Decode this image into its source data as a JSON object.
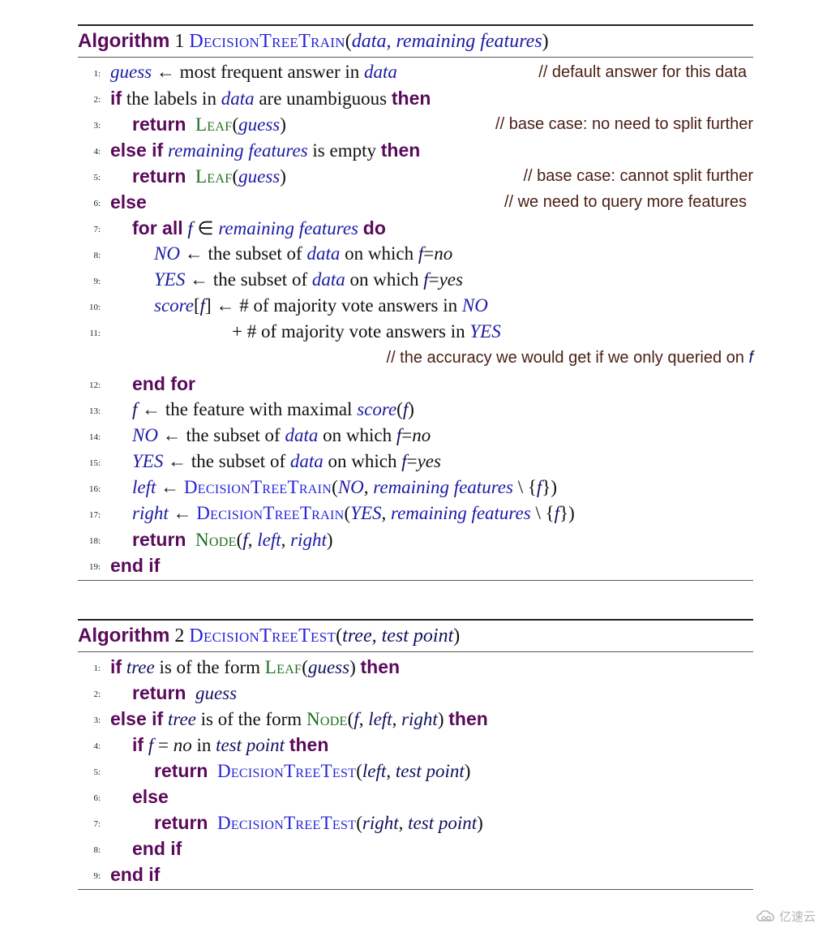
{
  "algorithm1": {
    "label": "Algorithm",
    "number": "1",
    "name": "DecisionTreeTrain",
    "params": "data, remaining features",
    "lines": [
      {
        "num": "1:",
        "parts": [
          "guess",
          " ←  most frequent answer in ",
          "data"
        ],
        "comment": "// default answer for this data"
      },
      {
        "num": "2:",
        "kw1": "if",
        "text": " the labels in ",
        "var": "data",
        "text2": " are unambiguous ",
        "kw2": "then"
      },
      {
        "num": "3:",
        "kw": "return",
        "func": "Leaf",
        "arg": "guess",
        "comment": "// base case: no need to split further"
      },
      {
        "num": "4:",
        "kw1": "else if",
        "var": "remaining features",
        "text": " is empty ",
        "kw2": "then"
      },
      {
        "num": "5:",
        "kw": "return",
        "func": "Leaf",
        "arg": "guess",
        "comment": "// base case: cannot split further"
      },
      {
        "num": "6:",
        "kw": "else",
        "comment": "// we need to query more features"
      },
      {
        "num": "7:",
        "kw1": "for all",
        "var1": "f",
        "sym": " ∈ ",
        "var2": "remaining features",
        "kw2": "do"
      },
      {
        "num": "8:",
        "var1": "NO",
        "text": " ←  the subset of ",
        "var2": "data",
        "text2": " on which ",
        "var3": "f",
        "eq": "=",
        "val": "no"
      },
      {
        "num": "9:",
        "var1": "YES",
        "text": " ←  the subset of ",
        "var2": "data",
        "text2": " on which ",
        "var3": "f",
        "eq": "=",
        "val": "yes"
      },
      {
        "num": "10:",
        "var1": "score",
        "br1": "[",
        "var2": "f",
        "br2": "]",
        "text": " ← # of majority vote answers in ",
        "var3": "NO"
      },
      {
        "num": "11:",
        "text": "+ # of majority vote answers in ",
        "var": "YES"
      },
      {
        "comment_text": "// the accuracy we would get if we only queried on ",
        "comment_var": "f"
      },
      {
        "num": "12:",
        "kw": "end for"
      },
      {
        "num": "13:",
        "var1": "f",
        "text": " ←  the feature with maximal ",
        "var2": "score",
        "p1": "(",
        "var3": "f",
        "p2": ")"
      },
      {
        "num": "14:",
        "var1": "NO",
        "text": " ←  the subset of ",
        "var2": "data",
        "text2": " on which ",
        "var3": "f",
        "eq": "=",
        "val": "no"
      },
      {
        "num": "15:",
        "var1": "YES",
        "text": " ←  the subset of ",
        "var2": "data",
        "text2": " on which ",
        "var3": "f",
        "eq": "=",
        "val": "yes"
      },
      {
        "num": "16:",
        "var1": "left",
        "arrow": " ←  ",
        "func": "DecisionTreeTrain",
        "arg1": "NO",
        "sep": ", ",
        "arg2": "remaining features",
        "set": " \\ {",
        "arg3": "f",
        "close": "})"
      },
      {
        "num": "17:",
        "var1": "right",
        "arrow": " ←  ",
        "func": "DecisionTreeTrain",
        "arg1": "YES",
        "sep": ", ",
        "arg2": "remaining features",
        "set": " \\ {",
        "arg3": "f",
        "close": "})"
      },
      {
        "num": "18:",
        "kw": "return",
        "func": "Node",
        "arg1": "f",
        "arg2": "left",
        "arg3": "right"
      },
      {
        "num": "19:",
        "kw": "end if"
      }
    ]
  },
  "algorithm2": {
    "label": "Algorithm",
    "number": "2",
    "name": "DecisionTreeTest",
    "params": "tree, test point",
    "lines": [
      {
        "num": "1:",
        "kw1": "if",
        "var": "tree",
        "text": " is of the form ",
        "func": "Leaf",
        "arg": "guess",
        "kw2": "then"
      },
      {
        "num": "2:",
        "kw": "return",
        "var": "guess"
      },
      {
        "num": "3:",
        "kw1": "else if",
        "var": "tree",
        "text": " is of the form ",
        "func": "Node",
        "arg1": "f",
        "arg2": "left",
        "arg3": "right",
        "kw2": "then"
      },
      {
        "num": "4:",
        "kw1": "if",
        "var1": "f",
        "eq": " = ",
        "val": "no",
        "text": " in ",
        "var2": "test point",
        "kw2": "then"
      },
      {
        "num": "5:",
        "kw": "return",
        "func": "DecisionTreeTest",
        "arg1": "left",
        "arg2": "test point"
      },
      {
        "num": "6:",
        "kw": "else"
      },
      {
        "num": "7:",
        "kw": "return",
        "func": "DecisionTreeTest",
        "arg1": "right",
        "arg2": "test point"
      },
      {
        "num": "8:",
        "kw": "end if"
      },
      {
        "num": "9:",
        "kw": "end if"
      }
    ]
  },
  "common": {
    "comma": ", ",
    "lparen": "(",
    "rparen": ")",
    "space": " "
  },
  "watermark": {
    "text": "亿速云",
    "icon": "cloud-logo-icon"
  },
  "colors": {
    "keyword": "#5b0a5b",
    "function": "#2323d8",
    "constructor": "#1f6e1f",
    "variable": "#1a1aa6",
    "comment": "#4a1e14"
  }
}
